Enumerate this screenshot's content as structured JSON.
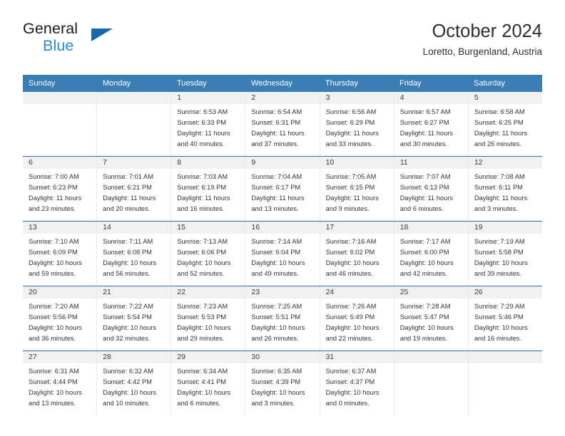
{
  "brand": {
    "name_part1": "General",
    "name_part2": "Blue",
    "triangle_color": "#1568b0",
    "blue_color": "#2a87d0"
  },
  "header": {
    "title": "October 2024",
    "subtitle": "Loretto, Burgenland, Austria"
  },
  "theme": {
    "header_blue": "#3b7db5",
    "row_divider_blue": "#2f6ea8",
    "day_band_gray": "#f1f1f1"
  },
  "weekdays": [
    "Sunday",
    "Monday",
    "Tuesday",
    "Wednesday",
    "Thursday",
    "Friday",
    "Saturday"
  ],
  "weeks": [
    [
      {
        "day": "",
        "sunrise": "",
        "sunset": "",
        "daylight1": "",
        "daylight2": ""
      },
      {
        "day": "",
        "sunrise": "",
        "sunset": "",
        "daylight1": "",
        "daylight2": ""
      },
      {
        "day": "1",
        "sunrise": "Sunrise: 6:53 AM",
        "sunset": "Sunset: 6:33 PM",
        "daylight1": "Daylight: 11 hours",
        "daylight2": "and 40 minutes."
      },
      {
        "day": "2",
        "sunrise": "Sunrise: 6:54 AM",
        "sunset": "Sunset: 6:31 PM",
        "daylight1": "Daylight: 11 hours",
        "daylight2": "and 37 minutes."
      },
      {
        "day": "3",
        "sunrise": "Sunrise: 6:56 AM",
        "sunset": "Sunset: 6:29 PM",
        "daylight1": "Daylight: 11 hours",
        "daylight2": "and 33 minutes."
      },
      {
        "day": "4",
        "sunrise": "Sunrise: 6:57 AM",
        "sunset": "Sunset: 6:27 PM",
        "daylight1": "Daylight: 11 hours",
        "daylight2": "and 30 minutes."
      },
      {
        "day": "5",
        "sunrise": "Sunrise: 6:58 AM",
        "sunset": "Sunset: 6:25 PM",
        "daylight1": "Daylight: 11 hours",
        "daylight2": "and 26 minutes."
      }
    ],
    [
      {
        "day": "6",
        "sunrise": "Sunrise: 7:00 AM",
        "sunset": "Sunset: 6:23 PM",
        "daylight1": "Daylight: 11 hours",
        "daylight2": "and 23 minutes."
      },
      {
        "day": "7",
        "sunrise": "Sunrise: 7:01 AM",
        "sunset": "Sunset: 6:21 PM",
        "daylight1": "Daylight: 11 hours",
        "daylight2": "and 20 minutes."
      },
      {
        "day": "8",
        "sunrise": "Sunrise: 7:03 AM",
        "sunset": "Sunset: 6:19 PM",
        "daylight1": "Daylight: 11 hours",
        "daylight2": "and 16 minutes."
      },
      {
        "day": "9",
        "sunrise": "Sunrise: 7:04 AM",
        "sunset": "Sunset: 6:17 PM",
        "daylight1": "Daylight: 11 hours",
        "daylight2": "and 13 minutes."
      },
      {
        "day": "10",
        "sunrise": "Sunrise: 7:05 AM",
        "sunset": "Sunset: 6:15 PM",
        "daylight1": "Daylight: 11 hours",
        "daylight2": "and 9 minutes."
      },
      {
        "day": "11",
        "sunrise": "Sunrise: 7:07 AM",
        "sunset": "Sunset: 6:13 PM",
        "daylight1": "Daylight: 11 hours",
        "daylight2": "and 6 minutes."
      },
      {
        "day": "12",
        "sunrise": "Sunrise: 7:08 AM",
        "sunset": "Sunset: 6:11 PM",
        "daylight1": "Daylight: 11 hours",
        "daylight2": "and 3 minutes."
      }
    ],
    [
      {
        "day": "13",
        "sunrise": "Sunrise: 7:10 AM",
        "sunset": "Sunset: 6:09 PM",
        "daylight1": "Daylight: 10 hours",
        "daylight2": "and 59 minutes."
      },
      {
        "day": "14",
        "sunrise": "Sunrise: 7:11 AM",
        "sunset": "Sunset: 6:08 PM",
        "daylight1": "Daylight: 10 hours",
        "daylight2": "and 56 minutes."
      },
      {
        "day": "15",
        "sunrise": "Sunrise: 7:13 AM",
        "sunset": "Sunset: 6:06 PM",
        "daylight1": "Daylight: 10 hours",
        "daylight2": "and 52 minutes."
      },
      {
        "day": "16",
        "sunrise": "Sunrise: 7:14 AM",
        "sunset": "Sunset: 6:04 PM",
        "daylight1": "Daylight: 10 hours",
        "daylight2": "and 49 minutes."
      },
      {
        "day": "17",
        "sunrise": "Sunrise: 7:16 AM",
        "sunset": "Sunset: 6:02 PM",
        "daylight1": "Daylight: 10 hours",
        "daylight2": "and 46 minutes."
      },
      {
        "day": "18",
        "sunrise": "Sunrise: 7:17 AM",
        "sunset": "Sunset: 6:00 PM",
        "daylight1": "Daylight: 10 hours",
        "daylight2": "and 42 minutes."
      },
      {
        "day": "19",
        "sunrise": "Sunrise: 7:19 AM",
        "sunset": "Sunset: 5:58 PM",
        "daylight1": "Daylight: 10 hours",
        "daylight2": "and 39 minutes."
      }
    ],
    [
      {
        "day": "20",
        "sunrise": "Sunrise: 7:20 AM",
        "sunset": "Sunset: 5:56 PM",
        "daylight1": "Daylight: 10 hours",
        "daylight2": "and 36 minutes."
      },
      {
        "day": "21",
        "sunrise": "Sunrise: 7:22 AM",
        "sunset": "Sunset: 5:54 PM",
        "daylight1": "Daylight: 10 hours",
        "daylight2": "and 32 minutes."
      },
      {
        "day": "22",
        "sunrise": "Sunrise: 7:23 AM",
        "sunset": "Sunset: 5:53 PM",
        "daylight1": "Daylight: 10 hours",
        "daylight2": "and 29 minutes."
      },
      {
        "day": "23",
        "sunrise": "Sunrise: 7:25 AM",
        "sunset": "Sunset: 5:51 PM",
        "daylight1": "Daylight: 10 hours",
        "daylight2": "and 26 minutes."
      },
      {
        "day": "24",
        "sunrise": "Sunrise: 7:26 AM",
        "sunset": "Sunset: 5:49 PM",
        "daylight1": "Daylight: 10 hours",
        "daylight2": "and 22 minutes."
      },
      {
        "day": "25",
        "sunrise": "Sunrise: 7:28 AM",
        "sunset": "Sunset: 5:47 PM",
        "daylight1": "Daylight: 10 hours",
        "daylight2": "and 19 minutes."
      },
      {
        "day": "26",
        "sunrise": "Sunrise: 7:29 AM",
        "sunset": "Sunset: 5:46 PM",
        "daylight1": "Daylight: 10 hours",
        "daylight2": "and 16 minutes."
      }
    ],
    [
      {
        "day": "27",
        "sunrise": "Sunrise: 6:31 AM",
        "sunset": "Sunset: 4:44 PM",
        "daylight1": "Daylight: 10 hours",
        "daylight2": "and 13 minutes."
      },
      {
        "day": "28",
        "sunrise": "Sunrise: 6:32 AM",
        "sunset": "Sunset: 4:42 PM",
        "daylight1": "Daylight: 10 hours",
        "daylight2": "and 10 minutes."
      },
      {
        "day": "29",
        "sunrise": "Sunrise: 6:34 AM",
        "sunset": "Sunset: 4:41 PM",
        "daylight1": "Daylight: 10 hours",
        "daylight2": "and 6 minutes."
      },
      {
        "day": "30",
        "sunrise": "Sunrise: 6:35 AM",
        "sunset": "Sunset: 4:39 PM",
        "daylight1": "Daylight: 10 hours",
        "daylight2": "and 3 minutes."
      },
      {
        "day": "31",
        "sunrise": "Sunrise: 6:37 AM",
        "sunset": "Sunset: 4:37 PM",
        "daylight1": "Daylight: 10 hours",
        "daylight2": "and 0 minutes."
      },
      {
        "day": "",
        "sunrise": "",
        "sunset": "",
        "daylight1": "",
        "daylight2": ""
      },
      {
        "day": "",
        "sunrise": "",
        "sunset": "",
        "daylight1": "",
        "daylight2": ""
      }
    ]
  ]
}
